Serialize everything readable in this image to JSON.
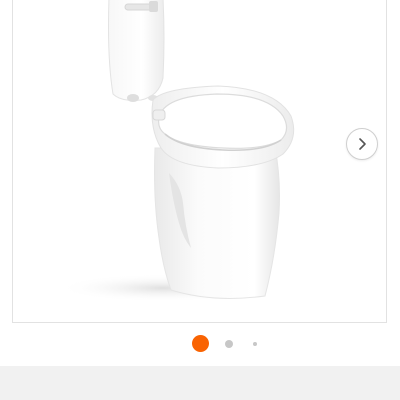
{
  "gallery": {
    "image_alt": "",
    "next_icon": "chevron-right-icon",
    "active_index": 1,
    "total_indicators": 3
  },
  "colors": {
    "accent": "#f96302",
    "indicator_inactive": "#c7c7c7",
    "frame_border": "#e2e2e2",
    "bottom_band": "#f1f1f1"
  }
}
